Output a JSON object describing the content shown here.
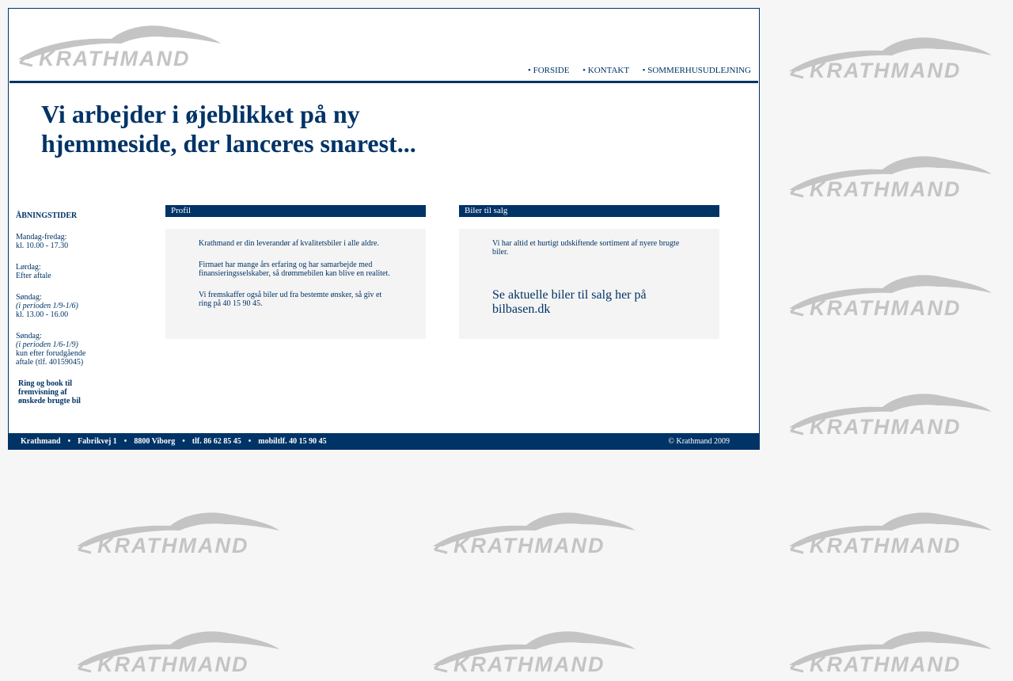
{
  "logo": {
    "text": "KRATHMAND"
  },
  "nav": {
    "items": [
      "• FORSIDE",
      "• KONTAKT",
      "• SOMMERHUSUDLEJNING"
    ]
  },
  "headline": "Vi arbejder i øjeblikket på ny hjemmeside, der lanceres snarest...",
  "hours": {
    "title": "ÅBNINGSTIDER",
    "weekdays_label": "Mandag-fredag:",
    "weekdays_time": "kl. 10.00 - 17.30",
    "saturday_label": "Lørdag:",
    "saturday_time": "Efter aftale",
    "sunday1_label": "Søndag:",
    "sunday1_period": "(i perioden 1/9-1/6)",
    "sunday1_time": "kl. 13.00 - 16.00",
    "sunday2_label": "Søndag:",
    "sunday2_period": "(i perioden 1/6-1/9)",
    "sunday2_time": "kun efter forudgående aftale (tlf. 40159045)",
    "cta": "Ring og book til fremvisning af ønskede brugte bil"
  },
  "profil": {
    "header": "Profil",
    "p1": "Krathmand er din leverandør af kvalitetsbiler i alle aldre.",
    "p2": "Firmaet har mange års erfaring og har samarbejde med finansieringsselskaber, så drømmebilen kan blive en realitet.",
    "p3": "Vi fremskaffer også biler ud fra bestemte ønsker, så giv et ring på 40 15 90 45."
  },
  "biler": {
    "header": "Biler til salg",
    "p1": "Vi har altid et hurtigt udskiftende sortiment af nyere brugte biler.",
    "link": "Se aktuelle biler til salg her på bilbasen.dk"
  },
  "footer": {
    "name": "Krathmand",
    "street": "Fabrikvej 1",
    "city": "8800 Viborg",
    "phone": "tlf. 86 62 85 45",
    "mobile": "mobiltlf. 40 15 90 45",
    "copyright": "© Krathmand 2009"
  },
  "colors": {
    "brand": "#003366",
    "panel_bg": "#f4f4f4",
    "logo_gray": "#c4c4c4"
  }
}
